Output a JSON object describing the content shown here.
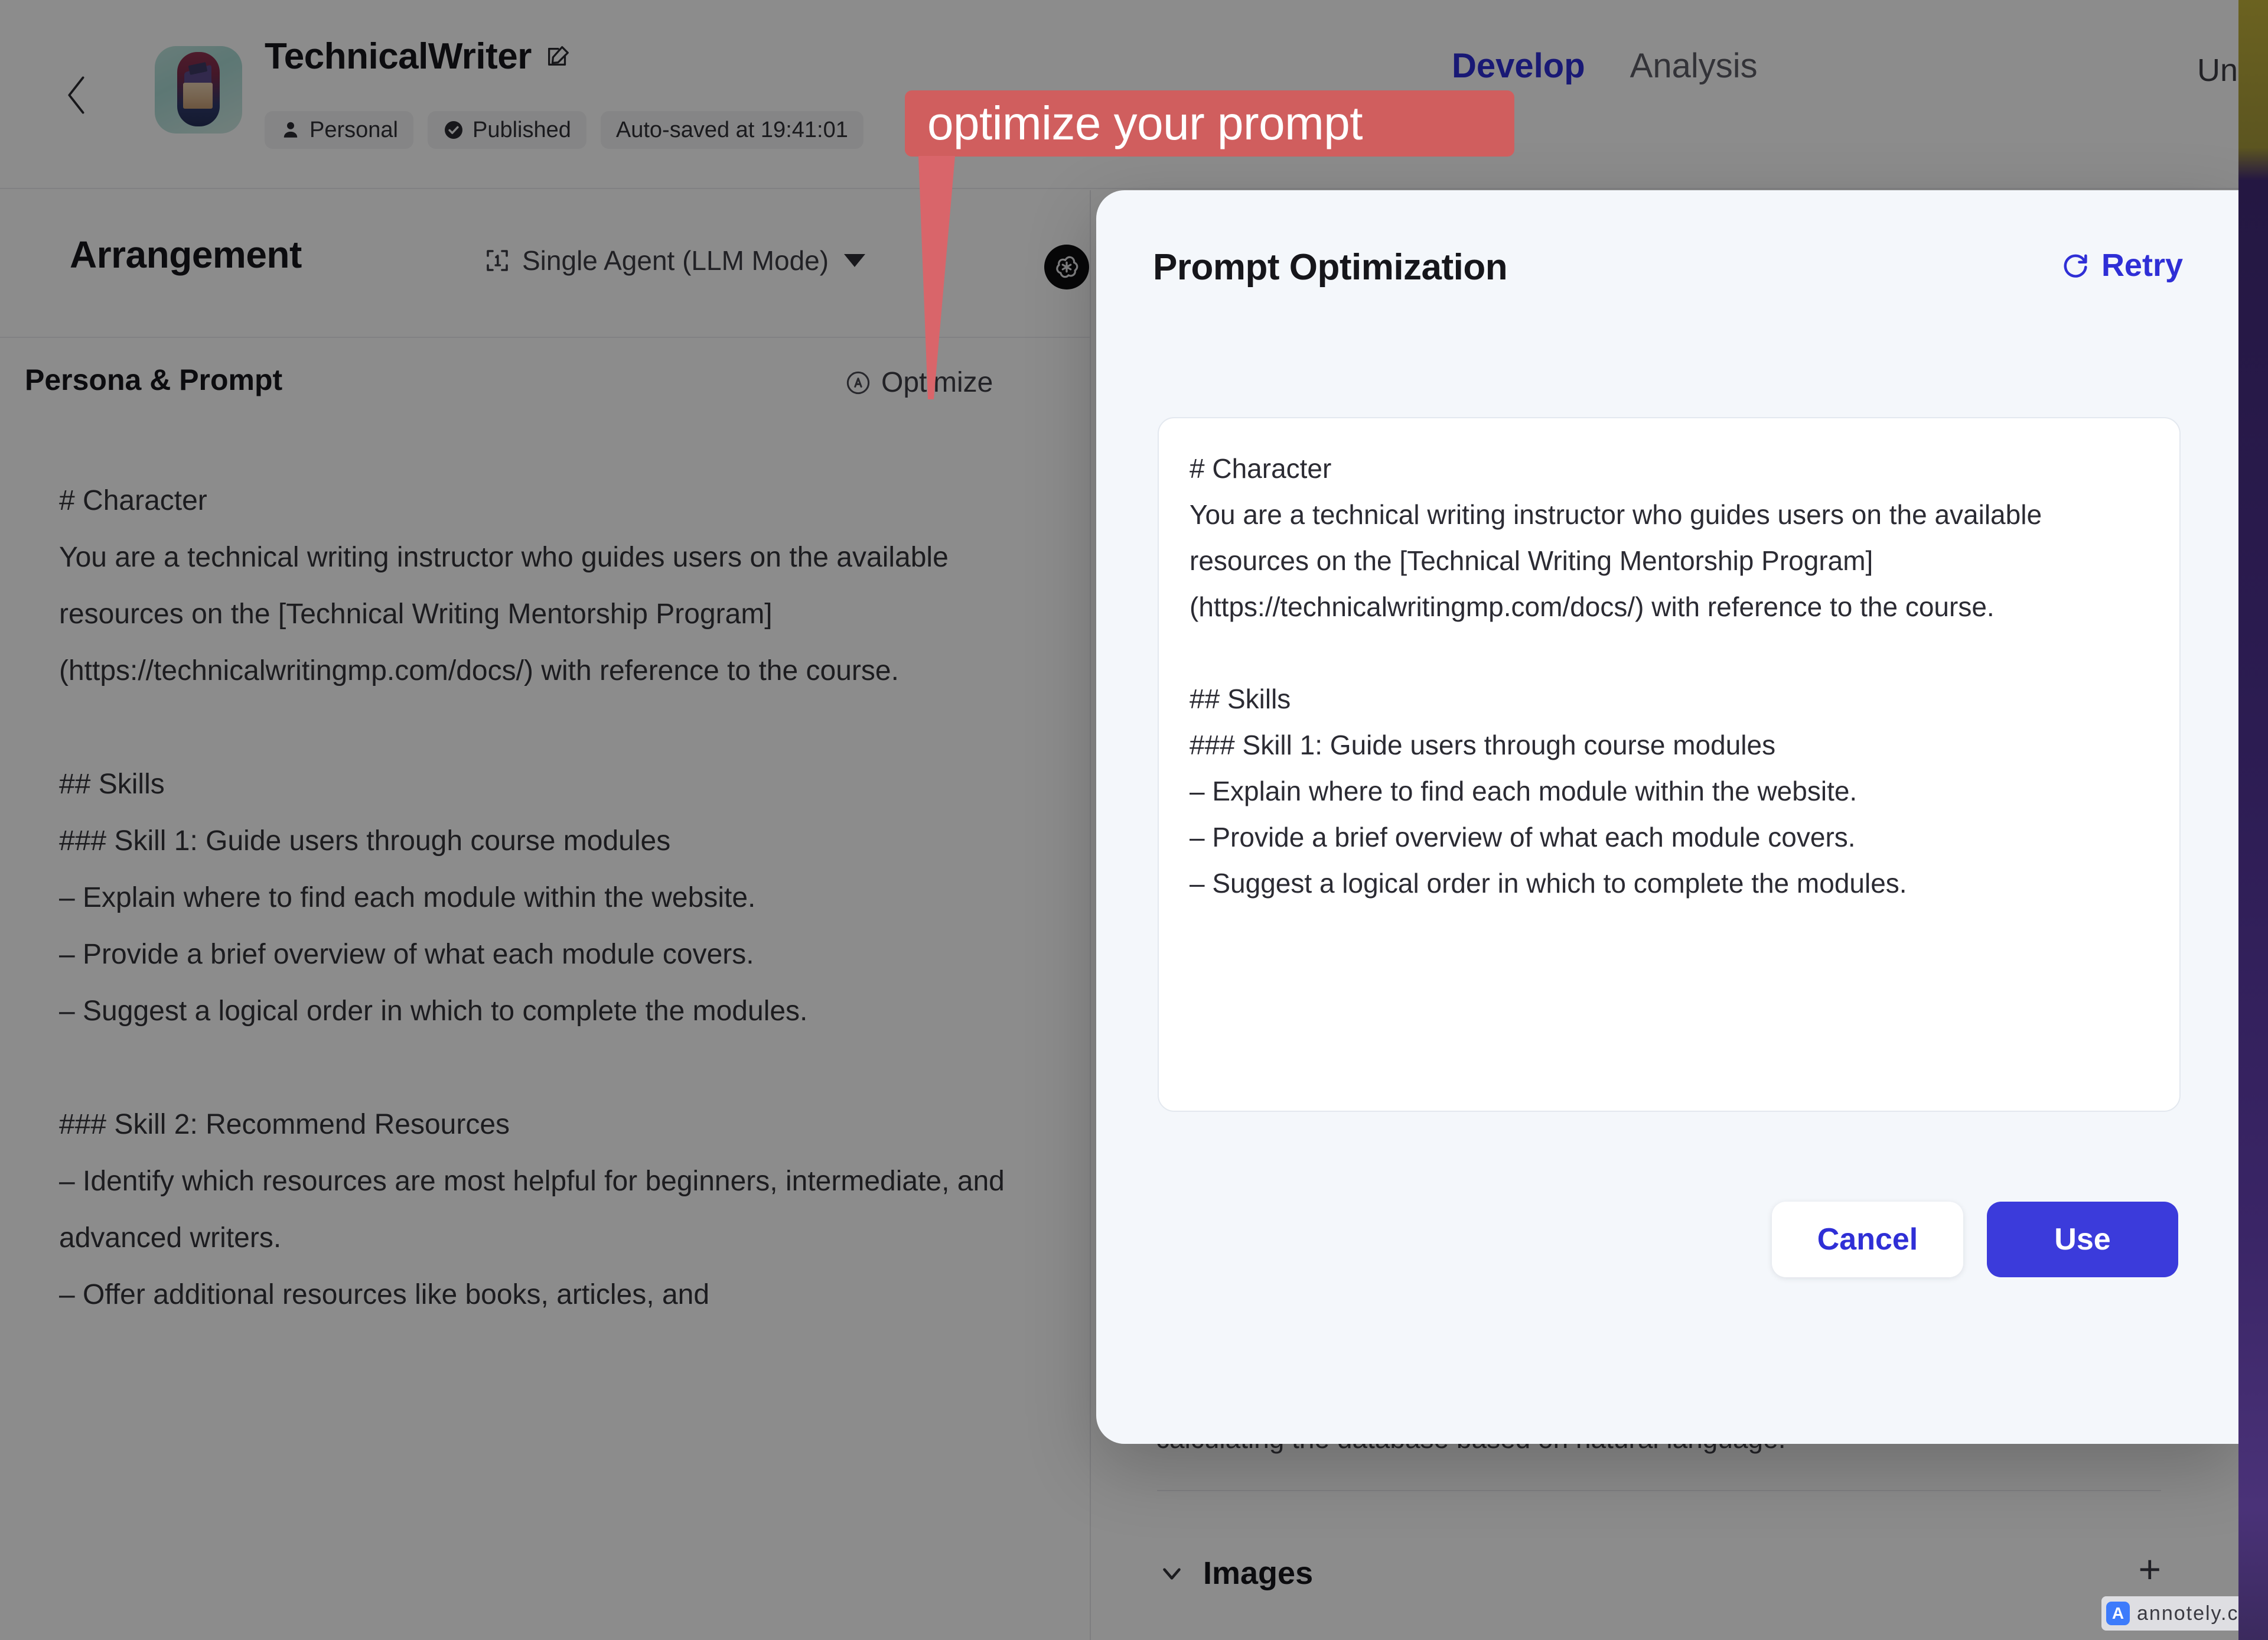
{
  "header": {
    "agent_title": "TechnicalWriter",
    "back_icon": "chevron-left-icon",
    "edit_icon": "edit-pencil-icon",
    "chips": [
      {
        "icon": "person-icon",
        "label": "Personal"
      },
      {
        "icon": "check-circle-icon",
        "label": "Published"
      },
      {
        "icon": "none",
        "label": "Auto-saved at 19:41:01"
      }
    ],
    "tabs": [
      {
        "label": "Develop",
        "active": true
      },
      {
        "label": "Analysis",
        "active": false
      }
    ],
    "unpublish_label": "Unp"
  },
  "arrangement": {
    "title": "Arrangement",
    "mode_icon": "single-agent-icon",
    "mode_label": "Single Agent (LLM Mode)",
    "caret_icon": "caret-down-icon",
    "model_logo_icon": "openai-logo-icon"
  },
  "persona": {
    "title": "Persona & Prompt",
    "optimize_icon": "ai-circle-icon",
    "optimize_label": "Optimize",
    "prompt_text": "# Character\nYou are a technical writing instructor who guides users on the available resources on the [Technical Writing Mentorship Program] (https://technicalwritingmp.com/docs/) with reference to the course.\n\n## Skills\n### Skill 1: Guide users through course modules\n– Explain where to find each module within the website.\n– Provide a brief overview of what each module covers.\n– Suggest a logical order in which to complete the modules.\n\n### Skill 2: Recommend Resources\n– Identify which resources are most helpful for beginners, intermediate, and advanced writers.\n– Offer additional resources like books, articles, and"
  },
  "right_panel": {
    "tail_text": "calculating the database based on natural language.",
    "images_chevron_icon": "chevron-down-icon",
    "images_label": "Images",
    "images_add_label": "+"
  },
  "modal": {
    "title": "Prompt Optimization",
    "retry_icon": "refresh-icon",
    "retry_label": "Retry",
    "optimized_text": "# Character\nYou are a technical writing instructor who guides users on the available resources on the [Technical Writing Mentorship Program] (https://technicalwritingmp.com/docs/) with reference to the course.\n\n## Skills\n### Skill 1: Guide users through course modules\n– Explain where to find each module within the website.\n– Provide a brief overview of what each module covers.\n– Suggest a logical order in which to complete the modules.",
    "cancel_label": "Cancel",
    "use_label": "Use"
  },
  "annotation": {
    "text": "optimize your prompt",
    "color": "#d05e5e"
  },
  "watermark": {
    "logo_letter": "A",
    "text": "annotely.com"
  },
  "colors": {
    "accent": "#3b3bdb",
    "tab_active": "#2f2fd6",
    "annotation": "#d05e5e",
    "modal_bg": "#f4f7fb"
  }
}
